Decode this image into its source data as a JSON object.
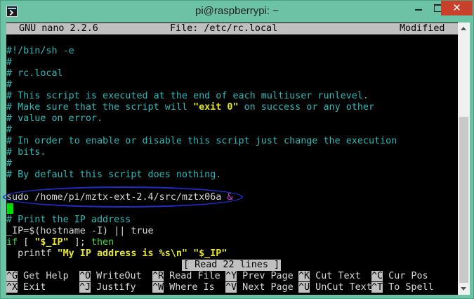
{
  "window": {
    "title": "pi@raspberrypi: ~",
    "close_glyph": "✕",
    "colors": {
      "frame": "#6cc2a4",
      "close": "#c7402c"
    }
  },
  "nano": {
    "version": "GNU nano 2.2.6",
    "file": "File: /etc/rc.local",
    "state": "Modified",
    "status_message": "[ Read 22 lines ]"
  },
  "editor": {
    "lines": [
      "#!/bin/sh -e",
      "#",
      "# rc.local",
      "#",
      "# This script is executed at the end of each multiuser runlevel.",
      "# Make sure that the script will ",
      "\"exit 0\"",
      " on success or any other",
      "# value on error.",
      "#",
      "# In order to enable or disable this script just change the execution",
      "# bits.",
      "#",
      "# By default this script does nothing.",
      "sudo /home/pi/mztx-ext-2.4/src/mztx06a",
      "&",
      "# Print the IP address",
      "_IP=$(hostname -I) || true",
      "if",
      " [ ",
      "\"$_IP\"",
      " ]; ",
      "then",
      "  printf ",
      "\"My IP address is %s\\n\"",
      " ",
      "\"$_IP\""
    ],
    "highlighted_command": "sudo /home/pi/mztx-ext-2.4/src/mztx06a &",
    "annotation_color": "#1a2fc9"
  },
  "shortcuts": [
    {
      "key": "^G",
      "label": " Get Help"
    },
    {
      "key": "^O",
      "label": " WriteOut"
    },
    {
      "key": "^R",
      "label": " Read File"
    },
    {
      "key": "^Y",
      "label": " Prev Page"
    },
    {
      "key": "^K",
      "label": " Cut Text"
    },
    {
      "key": "^C",
      "label": " Cur Pos"
    },
    {
      "key": "^X",
      "label": " Exit"
    },
    {
      "key": "^J",
      "label": " Justify"
    },
    {
      "key": "^W",
      "label": " Where Is"
    },
    {
      "key": "^V",
      "label": " Next Page"
    },
    {
      "key": "^U",
      "label": " UnCut Text"
    },
    {
      "key": "^T",
      "label": " To Spell"
    }
  ]
}
